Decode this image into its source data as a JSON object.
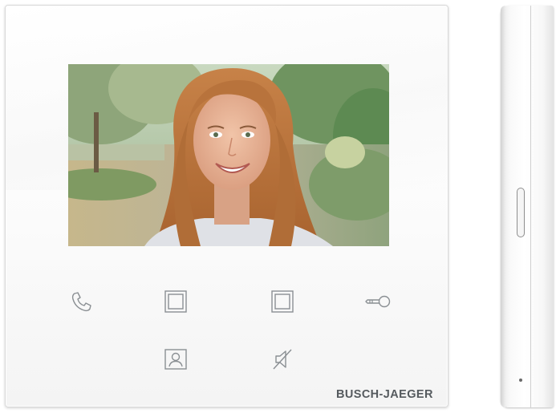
{
  "device": {
    "brand": "BUSCH-JAEGER",
    "screen_content": "video-feed-visitor"
  },
  "buttons": [
    {
      "name": "call-button",
      "icon": "phone-handset-icon"
    },
    {
      "name": "function-button-1",
      "icon": "square-icon"
    },
    {
      "name": "function-button-2",
      "icon": "square-icon"
    },
    {
      "name": "door-open-button",
      "icon": "key-icon"
    },
    {
      "name": "surveillance-button",
      "icon": "portrait-icon"
    },
    {
      "name": "mute-button",
      "icon": "speaker-muted-icon"
    }
  ],
  "colors": {
    "panel": "#ffffff",
    "icon_stroke": "#8a8f93",
    "brand_text": "#555a5e"
  }
}
